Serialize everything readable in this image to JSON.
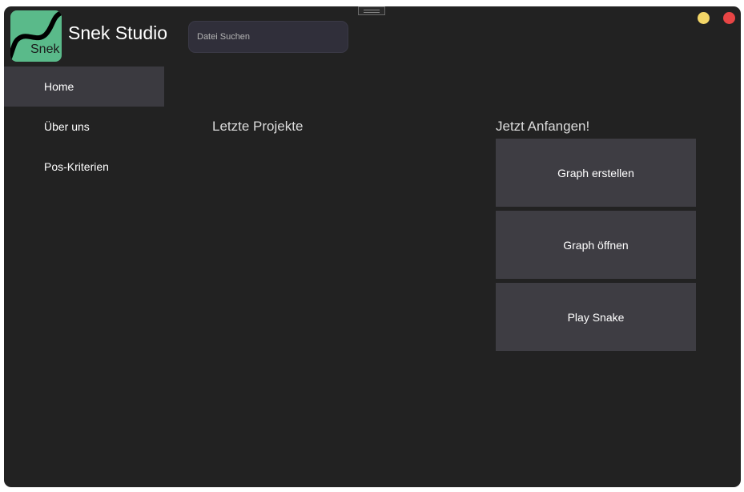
{
  "app": {
    "title": "Snek Studio",
    "logo_text": "Snek",
    "logo_color": "#5aba8a"
  },
  "window_controls": {
    "minimize_color": "#f3d667",
    "close_color": "#e84545"
  },
  "search": {
    "placeholder": "Datei Suchen",
    "value": ""
  },
  "sidebar": {
    "items": [
      {
        "label": "Home",
        "active": true
      },
      {
        "label": "Über uns",
        "active": false
      },
      {
        "label": "Pos-Kriterien",
        "active": false
      }
    ]
  },
  "main": {
    "recent_title": "Letzte Projekte",
    "start_title": "Jetzt Anfangen!",
    "actions": [
      {
        "label": "Graph erstellen"
      },
      {
        "label": "Graph öffnen"
      },
      {
        "label": "Play Snake"
      }
    ]
  },
  "icons": [
    "snake-logo-icon",
    "drag-handle-icon"
  ]
}
